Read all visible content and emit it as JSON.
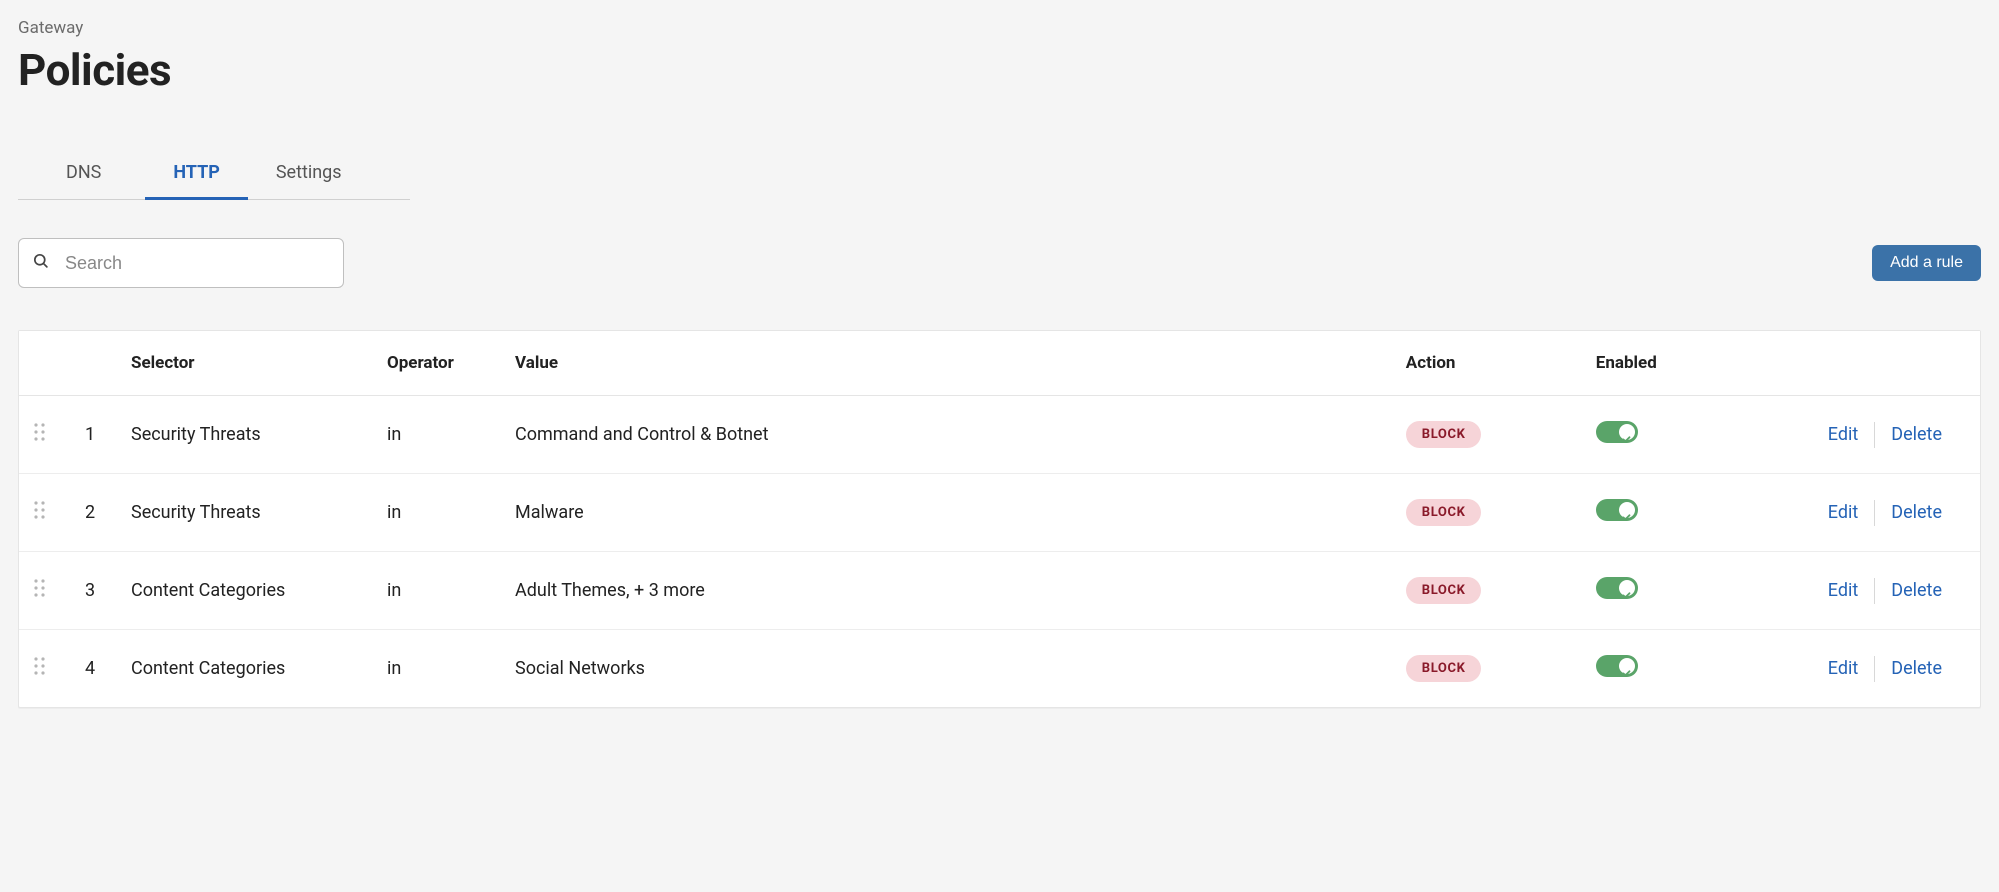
{
  "header": {
    "breadcrumb": "Gateway",
    "title": "Policies"
  },
  "tabs": [
    {
      "label": "DNS",
      "active": false
    },
    {
      "label": "HTTP",
      "active": true
    },
    {
      "label": "Settings",
      "active": false
    }
  ],
  "search": {
    "placeholder": "Search",
    "value": ""
  },
  "buttons": {
    "add_rule": "Add a rule"
  },
  "table": {
    "columns": {
      "selector": "Selector",
      "operator": "Operator",
      "value": "Value",
      "action": "Action",
      "enabled": "Enabled"
    },
    "row_actions": {
      "edit": "Edit",
      "delete": "Delete"
    },
    "rows": [
      {
        "index": "1",
        "selector": "Security Threats",
        "operator": "in",
        "value": "Command and Control & Botnet",
        "action": "BLOCK",
        "enabled": true
      },
      {
        "index": "2",
        "selector": "Security Threats",
        "operator": "in",
        "value": "Malware",
        "action": "BLOCK",
        "enabled": true
      },
      {
        "index": "3",
        "selector": "Content Categories",
        "operator": "in",
        "value": "Adult Themes, + 3 more",
        "action": "BLOCK",
        "enabled": true
      },
      {
        "index": "4",
        "selector": "Content Categories",
        "operator": "in",
        "value": "Social Networks",
        "action": "BLOCK",
        "enabled": true
      }
    ]
  }
}
